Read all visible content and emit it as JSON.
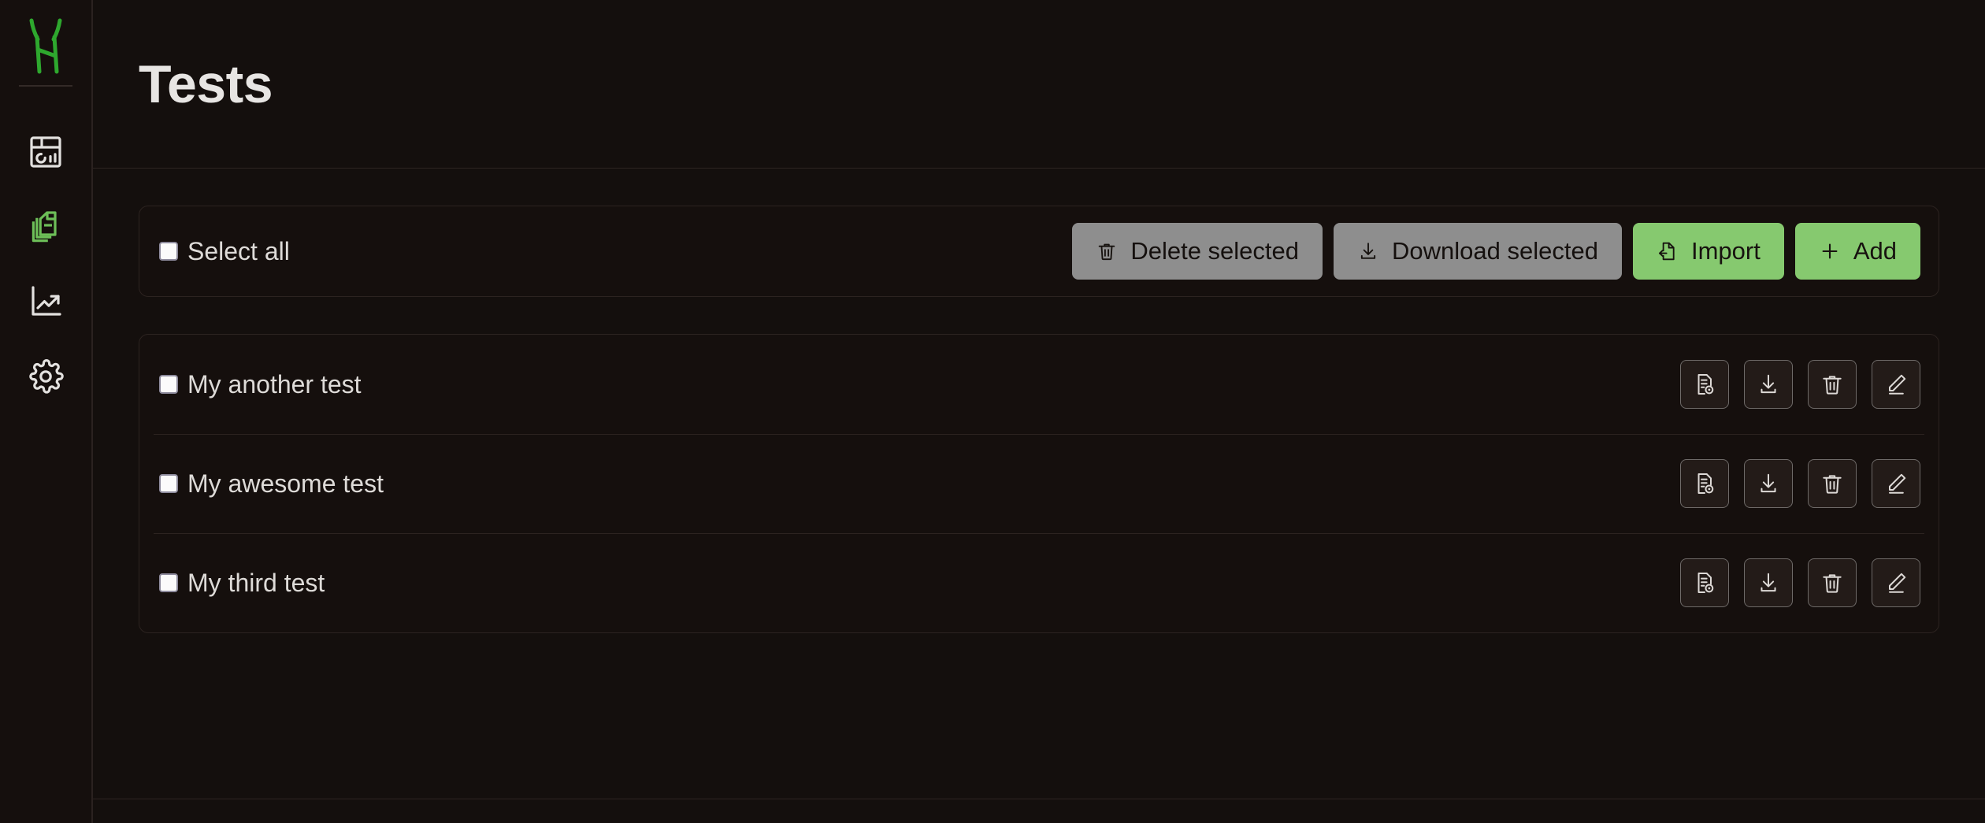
{
  "app": {
    "logo_name": "horned-h-logo",
    "accent_color": "#86c96f",
    "muted_button_color": "#8e8e8e",
    "background_color": "#140f0d",
    "sidebar_background": "#150f0d",
    "border_color": "#2c2320",
    "text_color": "#dedbd8"
  },
  "sidebar": {
    "items": [
      {
        "name": "dashboard",
        "icon": "dashboard-grid-icon",
        "active": false
      },
      {
        "name": "documents",
        "icon": "copy-documents-icon",
        "active": true
      },
      {
        "name": "analytics",
        "icon": "trending-up-chart-icon",
        "active": false
      },
      {
        "name": "settings",
        "icon": "gear-icon",
        "active": false
      }
    ]
  },
  "header": {
    "title": "Tests"
  },
  "toolbar": {
    "select_all_label": "Select all",
    "select_all_checked": false,
    "buttons": [
      {
        "label": "Delete selected",
        "icon": "trash-icon",
        "style": "muted"
      },
      {
        "label": "Download selected",
        "icon": "download-icon",
        "style": "muted"
      },
      {
        "label": "Import",
        "icon": "file-import-icon",
        "style": "accent"
      },
      {
        "label": "Add",
        "icon": "plus-icon",
        "style": "accent"
      }
    ]
  },
  "tests": {
    "row_action_icons": [
      "document-preview-icon",
      "download-icon",
      "trash-icon",
      "pencil-edit-icon"
    ],
    "rows": [
      {
        "label": "My another test",
        "checked": false
      },
      {
        "label": "My awesome test",
        "checked": false
      },
      {
        "label": "My third test",
        "checked": false
      }
    ]
  }
}
